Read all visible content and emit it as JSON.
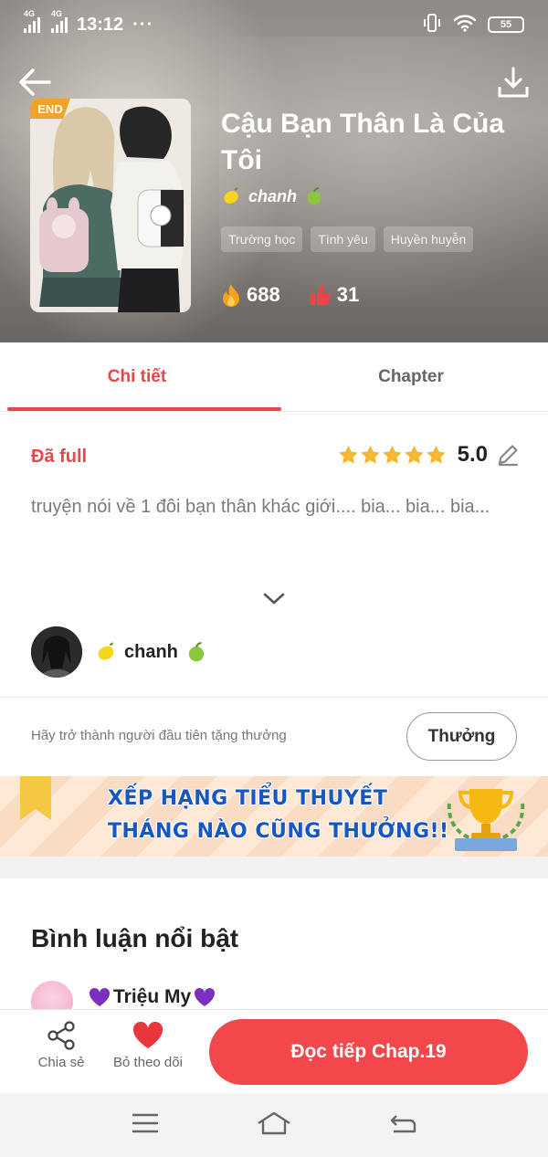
{
  "status_bar": {
    "network_left": "4G",
    "network_right": "4G",
    "time": "13:12",
    "dots": "···",
    "battery": "55"
  },
  "story": {
    "badge": "END",
    "title": "Cậu Bạn Thân Là Của Tôi",
    "author": "chanh",
    "tags": [
      "Trường học",
      "Tình yêu",
      "Huyền huyễn"
    ],
    "views": "688",
    "likes": "31"
  },
  "tabs": [
    {
      "label": "Chi tiết",
      "active": true
    },
    {
      "label": "Chapter",
      "active": false
    }
  ],
  "details": {
    "status": "Đã full",
    "rating": "5.0",
    "stars": 5,
    "description": "truyện nói về 1 đôi bạn thân khác giới.... bia... bia... bia...",
    "author_name": "chanh"
  },
  "reward": {
    "prompt": "Hãy trở thành người đầu tiên tặng thưởng",
    "button": "Thưởng"
  },
  "banner": {
    "line1": "XẾP HẠNG TIỂU THUYẾT",
    "line2": "THÁNG NÀO CŨNG THƯỞNG!!"
  },
  "comments": {
    "title": "Bình luận nổi bật",
    "first_user": "Triệu My"
  },
  "actions": {
    "share": "Chia sẻ",
    "unfollow": "Bỏ theo dõi",
    "read": "Đọc tiếp Chap.19"
  },
  "colors": {
    "accent": "#e8464b",
    "read_button": "#f2484c",
    "banner_text": "#1757c2"
  }
}
